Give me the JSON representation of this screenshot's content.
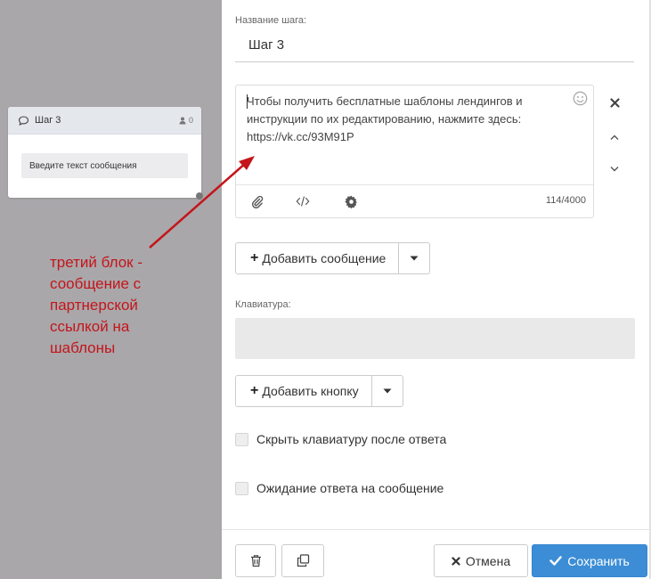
{
  "canvas": {
    "node": {
      "title": "Шаг 3",
      "user_count": "0",
      "message_placeholder": "Введите текст сообщения"
    },
    "annotation": "третий блок - сообщение с партнерской ссылкой на шаблоны",
    "annotation_color": "#c4151b"
  },
  "editor": {
    "step_name_label": "Название шага:",
    "step_name_value": "Шаг 3",
    "message": {
      "text": "Чтобы получить бесплатные шаблоны лендингов и инструкции по их редактированию, нажмите здесь: https://vk.cc/93M91P",
      "counter": "114/4000",
      "icons": [
        "smile-icon",
        "paperclip-icon",
        "code-icon",
        "gear-icon"
      ]
    },
    "side_controls": [
      "close-icon",
      "chevron-up-icon",
      "chevron-down-icon"
    ],
    "add_message_label": "Добавить сообщение",
    "keyboard_label": "Клавиатура:",
    "add_button_label": "Добавить кнопку",
    "hide_keyboard_label": "Скрыть клавиатуру после ответа",
    "wait_answer_label": "Ожидание ответа на сообщение"
  },
  "footer": {
    "cancel_label": "Отмена",
    "save_label": "Сохранить",
    "primary_color": "#3c8dd6"
  }
}
